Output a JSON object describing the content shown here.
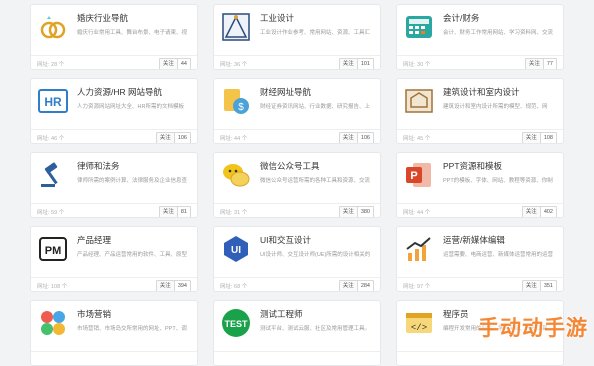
{
  "cards": [
    {
      "title": "婚庆行业导航",
      "desc": "婚庆行业常用工具、舞台布景、电子请柬、视",
      "visits": "网址: 28 个",
      "follow_label": "关注",
      "follow_count": "44",
      "icon": "rings-icon"
    },
    {
      "title": "工业设计",
      "desc": "工业设计作业参考、常用网站、资源、工具汇",
      "visits": "网址: 36 个",
      "follow_label": "关注",
      "follow_count": "101",
      "icon": "drafting-icon"
    },
    {
      "title": "会计/财务",
      "desc": "会计、财务工作常用网站、学习资料网、交流",
      "visits": "网址: 30 个",
      "follow_label": "关注",
      "follow_count": "77",
      "icon": "calculator-icon"
    },
    {
      "title": "人力资源/HR 网站导航",
      "desc": "人力资源网站网址大全、HR所需的文档模板",
      "visits": "网址: 46 个",
      "follow_label": "关注",
      "follow_count": "106",
      "icon": "hr-icon"
    },
    {
      "title": "财经网址导航",
      "desc": "财经证券资讯网站、行业数据、研究报告、上",
      "visits": "网址: 44 个",
      "follow_label": "关注",
      "follow_count": "106",
      "icon": "finance-icon"
    },
    {
      "title": "建筑设计和室内设计",
      "desc": "建筑设计和室内设计所需的模型、规范、网",
      "visits": "网址: 45 个",
      "follow_label": "关注",
      "follow_count": "108",
      "icon": "blueprint-icon"
    },
    {
      "title": "律师和法务",
      "desc": "律师所需的案例计算、法律服务及企业信息查",
      "visits": "网址: 59 个",
      "follow_label": "关注",
      "follow_count": "81",
      "icon": "gavel-icon"
    },
    {
      "title": "微信公众号工具",
      "desc": "微信公众号运营所需的各种工具和资源、交流",
      "visits": "网址: 31 个",
      "follow_label": "关注",
      "follow_count": "380",
      "icon": "wechat-icon"
    },
    {
      "title": "PPT资源和模板",
      "desc": "PPT的模板、字体、网站、教程等资源、你制",
      "visits": "网址: 44 个",
      "follow_label": "关注",
      "follow_count": "402",
      "icon": "ppt-icon"
    },
    {
      "title": "产品经理",
      "desc": "产品经理、产品运营常用的软件、工具、原型",
      "visits": "网址: 108 个",
      "follow_label": "关注",
      "follow_count": "394",
      "icon": "pm-icon"
    },
    {
      "title": "UI和交互设计",
      "desc": "UI设计师、交互设计师(UE)所需的设计相关的",
      "visits": "网址: 68 个",
      "follow_label": "关注",
      "follow_count": "284",
      "icon": "ui-icon"
    },
    {
      "title": "运营/新媒体编辑",
      "desc": "运营需要、电商运营、新媒体运营常用的运营",
      "visits": "网址: 97 个",
      "follow_label": "关注",
      "follow_count": "351",
      "icon": "chart-up-icon"
    },
    {
      "title": "市场营销",
      "desc": "市场营销、市场岛交所常用的网址、PPT、调",
      "visits": "",
      "follow_label": "",
      "follow_count": "",
      "icon": "marketing-icon"
    },
    {
      "title": "测试工程师",
      "desc": "测试平台、测试云服、社区及常用管理工具。",
      "visits": "",
      "follow_label": "",
      "follow_count": "",
      "icon": "test-icon"
    },
    {
      "title": "程序员",
      "desc": "编程开发常用的网站、学习平台、代码工具、",
      "visits": "",
      "follow_label": "",
      "follow_count": "",
      "icon": "code-icon"
    }
  ],
  "watermark": "手动动手游",
  "colors": {
    "accent": "#f47c20",
    "blue": "#2f7ec9",
    "green": "#1aa24a",
    "red": "#d9472b"
  }
}
